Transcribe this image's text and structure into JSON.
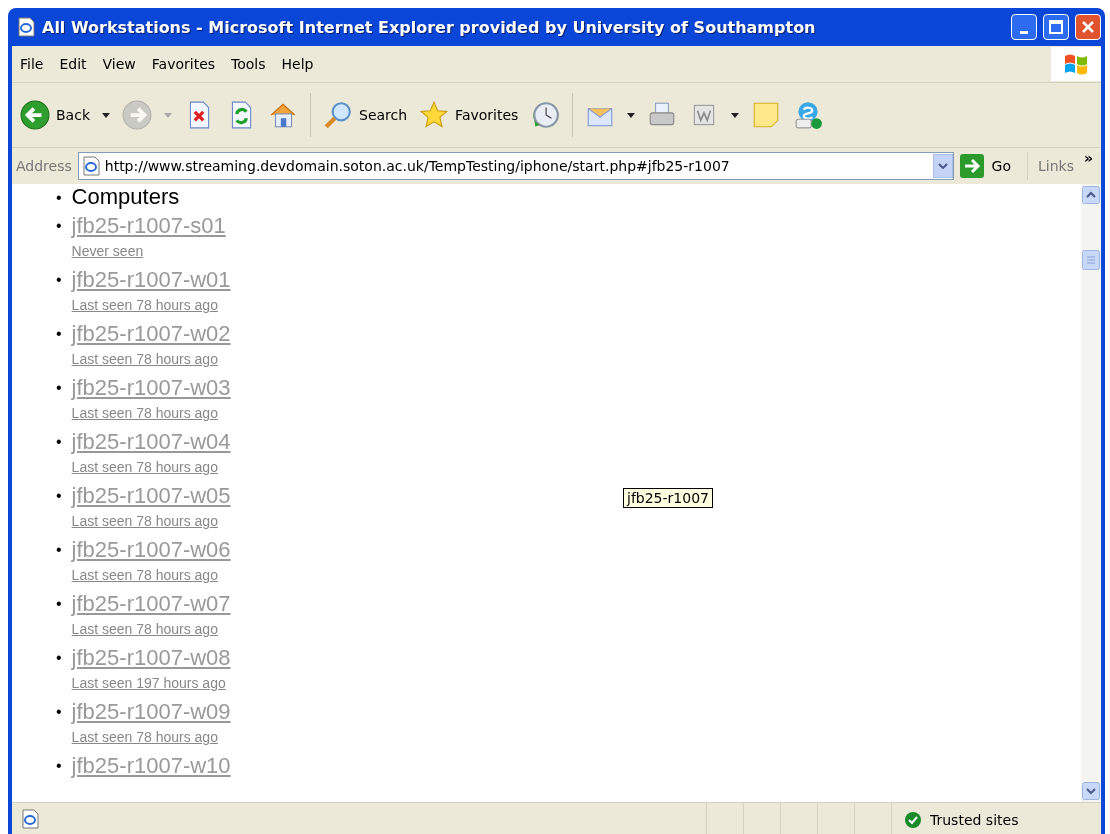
{
  "window": {
    "title": "All Workstations - Microsoft Internet Explorer provided by University of Southampton"
  },
  "menu": [
    "File",
    "Edit",
    "View",
    "Favorites",
    "Tools",
    "Help"
  ],
  "toolbar": [
    {
      "kind": "back",
      "label": "Back",
      "disabled": false
    },
    {
      "kind": "forward",
      "disabled": true
    },
    {
      "kind": "stop",
      "disabled": false
    },
    {
      "kind": "refresh",
      "disabled": false
    },
    {
      "kind": "home",
      "disabled": false
    },
    {
      "kind": "search",
      "label": "Search",
      "disabled": false
    },
    {
      "kind": "favorites",
      "label": "Favorites",
      "disabled": false
    },
    {
      "kind": "history",
      "disabled": false
    },
    {
      "kind": "mail",
      "disabled": false
    },
    {
      "kind": "print",
      "disabled": false
    },
    {
      "kind": "word",
      "disabled": false
    },
    {
      "kind": "note",
      "disabled": false
    },
    {
      "kind": "skype",
      "disabled": false
    }
  ],
  "address": {
    "label": "Address",
    "url": "http://www.streaming.devdomain.soton.ac.uk/TempTesting/iphone/start.php#jfb25-r1007",
    "go": "Go",
    "links": "Links",
    "more": "»"
  },
  "content": {
    "marker": "•",
    "heading": "Computers",
    "computers": [
      {
        "name": "jfb25-r1007-s01",
        "status": "Never seen"
      },
      {
        "name": "jfb25-r1007-w01",
        "status": "Last seen 78 hours ago"
      },
      {
        "name": "jfb25-r1007-w02",
        "status": "Last seen 78 hours ago"
      },
      {
        "name": "jfb25-r1007-w03",
        "status": "Last seen 78 hours ago"
      },
      {
        "name": "jfb25-r1007-w04",
        "status": "Last seen 78 hours ago"
      },
      {
        "name": "jfb25-r1007-w05",
        "status": "Last seen 78 hours ago"
      },
      {
        "name": "jfb25-r1007-w06",
        "status": "Last seen 78 hours ago"
      },
      {
        "name": "jfb25-r1007-w07",
        "status": "Last seen 78 hours ago"
      },
      {
        "name": "jfb25-r1007-w08",
        "status": "Last seen 197 hours ago"
      },
      {
        "name": "jfb25-r1007-w09",
        "status": "Last seen 78 hours ago"
      },
      {
        "name": "jfb25-r1007-w10"
      }
    ],
    "tooltip": "jfb25-r1007"
  },
  "status_bar": {
    "zone": "Trusted sites"
  }
}
